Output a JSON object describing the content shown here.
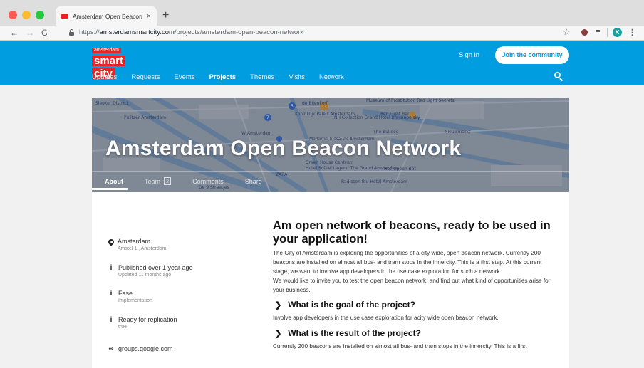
{
  "browser": {
    "tab_title": "Amsterdam Open Beacon Netw",
    "tab_close": "×",
    "new_tab": "+",
    "url_scheme": "https://",
    "url_host": "amsterdamsmartcity.com",
    "url_path": "/projects/amsterdam-open-beacon-network",
    "profile_initial": "K",
    "nav_back": "←",
    "nav_forward": "→",
    "nav_reload": "C",
    "star": "☆",
    "menu": "⋮",
    "ext_menu": "≡"
  },
  "site": {
    "logo_top": "amsterdam",
    "logo_line1": "smart",
    "logo_line2": "city",
    "sign_in": "Sign in",
    "join_label": "Join the community",
    "nav": [
      "Updates",
      "Requests",
      "Events",
      "Projects",
      "Themes",
      "Visits",
      "Network"
    ],
    "nav_active": "Projects",
    "accent_color": "#009de0",
    "brand_red": "#ec2227"
  },
  "hero": {
    "title": "Amsterdam Open Beacon Network",
    "tabs": {
      "about": "About",
      "team": "Team",
      "team_count": "2",
      "comments": "Comments",
      "share": "Share"
    },
    "map_labels": [
      "Sleeker District",
      "Pulitzer Amsterdam",
      "W Amsterdam",
      "Koninklijk Paleis Amsterdam",
      "de Bijenkorf",
      "NH Collection Grand Hotel Krasnapolsky",
      "Museum of Prostitution Red Light Secrets",
      "Red Light Bar",
      "Madame Tussauds Amsterdam",
      "The Bulldog",
      "Nieuwmarkt",
      "Green House Centrum",
      "Hotel Sofitel Legend The Grand Amsterdam",
      "Het Tippen Bot",
      "ZARA",
      "Radisson Blu Hotel Amsterdam",
      "De 9 Straatjes"
    ],
    "map_markers": [
      "7",
      "5",
      "12"
    ]
  },
  "sidebar": [
    {
      "icon": "pin-icon",
      "main": "Amsterdam",
      "sub": "Amstel 1 , Amsterdam"
    },
    {
      "icon": "info-icon",
      "main": "Published over 1 year ago",
      "sub": "Updated 11 months ago"
    },
    {
      "icon": "info-icon",
      "main": "Fase",
      "sub": "Implementation"
    },
    {
      "icon": "info-icon",
      "main": "Ready for replication",
      "sub": "true"
    },
    {
      "icon": "link-icon",
      "main": "groups.google.com",
      "sub": ""
    }
  ],
  "content": {
    "heading": "Am open network of beacons, ready to be used in your application!",
    "intro": "The City of Amsterdam is exploring the opportunities of a city wide, open beacon network. Currently 200 beacons are installed on almost all bus- and tram stops in the innercity. This is a first step. At this current stage, we want to involve app developers in the use case exploration for such a network.",
    "invite": "We would like to invite you to test the open beacon network, and find out what kind of opportunities arise for your business.",
    "goal_title": "What is the goal of the project?",
    "goal_text": "Involve app developers in the use case exploration for acity wide open beacon network.",
    "result_title": "What is the result of the project?",
    "result_text": "Currently 200 beacons are installed on almost all bus- and tram stops in the innercity. This is a first"
  }
}
